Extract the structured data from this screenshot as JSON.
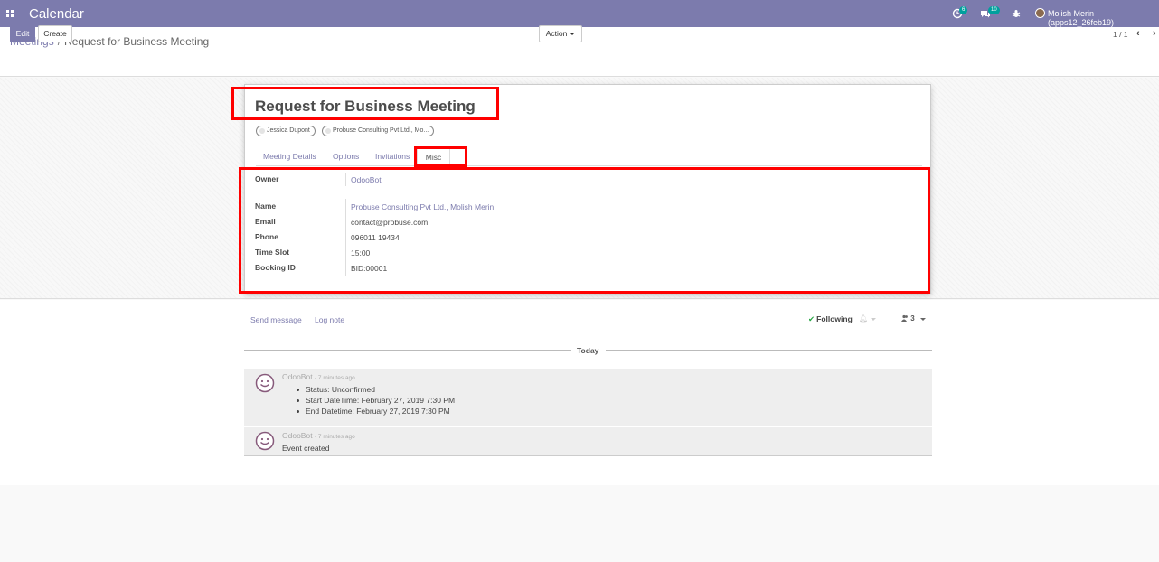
{
  "navbar": {
    "app_title": "Calendar",
    "activity_count": "6",
    "message_count": "10",
    "user_name": "Molish Merin (apps12_26feb19)"
  },
  "breadcrumb": {
    "parent": "Meetings",
    "separator": "/",
    "current": "Request for Business Meeting"
  },
  "buttons": {
    "edit": "Edit",
    "create": "Create",
    "action": "Action"
  },
  "pager": {
    "value": "1 / 1"
  },
  "form": {
    "title": "Request for Business Meeting",
    "attendees": [
      "Jessica Dupont",
      "Probuse Consulting Pvt Ltd., Mo..."
    ],
    "tabs": [
      "Meeting Details",
      "Options",
      "Invitations",
      "Misc"
    ],
    "active_tab": "Misc",
    "fields": {
      "owner_label": "Owner",
      "owner_value": "OdooBot",
      "name_label": "Name",
      "name_value": "Probuse Consulting Pvt Ltd., Molish Merin",
      "email_label": "Email",
      "email_value": "contact@probuse.com",
      "phone_label": "Phone",
      "phone_value": "096011 19434",
      "timeslot_label": "Time Slot",
      "timeslot_value": "15:00",
      "booking_label": "Booking ID",
      "booking_value": "BID:00001"
    }
  },
  "chatter": {
    "send_message": "Send message",
    "log_note": "Log note",
    "following": "Following",
    "followers_count": "3",
    "today": "Today",
    "messages": [
      {
        "author": "OdooBot",
        "time": "- 7 minutes ago",
        "items": [
          "Status: Unconfirmed",
          "Start DateTime: February 27, 2019 7:30 PM",
          "End Datetime: February 27, 2019 7:30 PM"
        ]
      },
      {
        "author": "OdooBot",
        "time": "- 7 minutes ago",
        "body": "Event created"
      }
    ]
  },
  "colors": {
    "brand": "#7c7bad",
    "badge": "#00a09d",
    "annotation": "#ff0000"
  }
}
